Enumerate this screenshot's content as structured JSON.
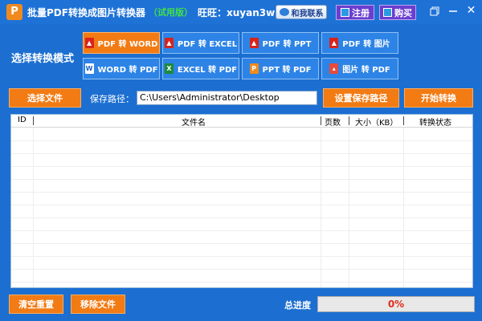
{
  "app": {
    "logo_letter": "P",
    "title": "批量PDF转换成图片转换器",
    "trial": "（试用版）",
    "wangwang": "旺旺：xuyan3w"
  },
  "header": {
    "contact_label": "和我联系",
    "register_label": "注册",
    "buy_label": "购买"
  },
  "mode": {
    "label": "选择转换模式",
    "buttons": [
      {
        "label": "PDF 转 WORD",
        "icon": "pdf-icon",
        "active": true
      },
      {
        "label": "PDF 转 EXCEL",
        "icon": "pdf-icon",
        "active": false
      },
      {
        "label": "PDF 转 PPT",
        "icon": "pdf-icon",
        "active": false
      },
      {
        "label": "PDF 转 图片",
        "icon": "pdf-icon",
        "active": false
      },
      {
        "label": "WORD 转 PDF",
        "icon": "word-icon",
        "active": false
      },
      {
        "label": "EXCEL 转 PDF",
        "icon": "excel-icon",
        "active": false
      },
      {
        "label": "PPT 转 PDF",
        "icon": "ppt-icon",
        "active": false
      },
      {
        "label": "图片 转 PDF",
        "icon": "image-icon",
        "active": false
      }
    ]
  },
  "toolbar": {
    "select_file": "选择文件",
    "save_path_label": "保存路径：",
    "save_path_value": "C:\\Users\\Administrator\\Desktop",
    "set_save_path": "设置保存路径",
    "start": "开始转换"
  },
  "table": {
    "columns": [
      "ID",
      "文件名",
      "页数",
      "大小（KB）",
      "转换状态"
    ],
    "rows": []
  },
  "footer": {
    "clear_reset": "清空重置",
    "remove_file": "移除文件",
    "progress_label": "总进度",
    "progress_text": "0%",
    "progress_value": 0
  },
  "colors": {
    "background": "#1c6fd1",
    "accent_orange": "#f27b14",
    "mode_button": "#2d84e6",
    "purple_button": "#6a3fd0",
    "trial_green": "#3fe04a",
    "progress_text": "#e0301e"
  }
}
